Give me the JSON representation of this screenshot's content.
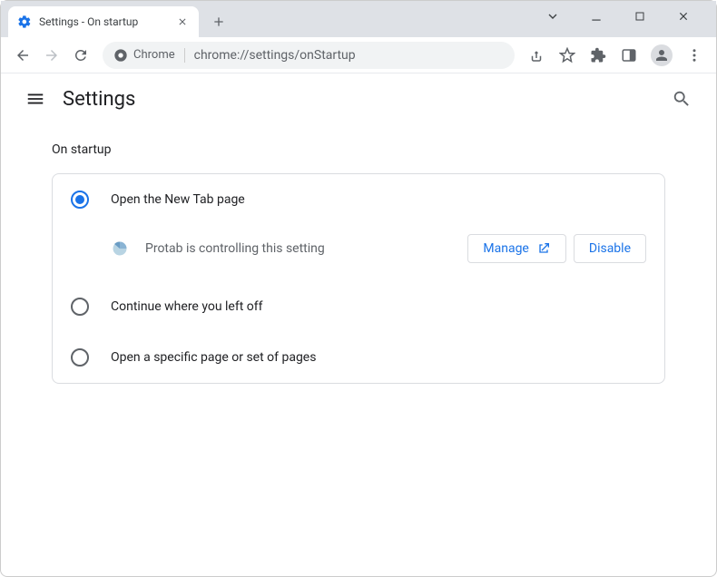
{
  "tab": {
    "title": "Settings - On startup"
  },
  "addressbar": {
    "chip_label": "Chrome",
    "url": "chrome://settings/onStartup"
  },
  "header": {
    "title": "Settings"
  },
  "section": {
    "title": "On startup",
    "options": [
      {
        "label": "Open the New Tab page",
        "selected": true
      },
      {
        "label": "Continue where you left off",
        "selected": false
      },
      {
        "label": "Open a specific page or set of pages",
        "selected": false
      }
    ],
    "extension": {
      "name": "Protab",
      "message": "Protab is controlling this setting",
      "manage_label": "Manage",
      "disable_label": "Disable"
    }
  },
  "colors": {
    "accent": "#1a73e8"
  }
}
